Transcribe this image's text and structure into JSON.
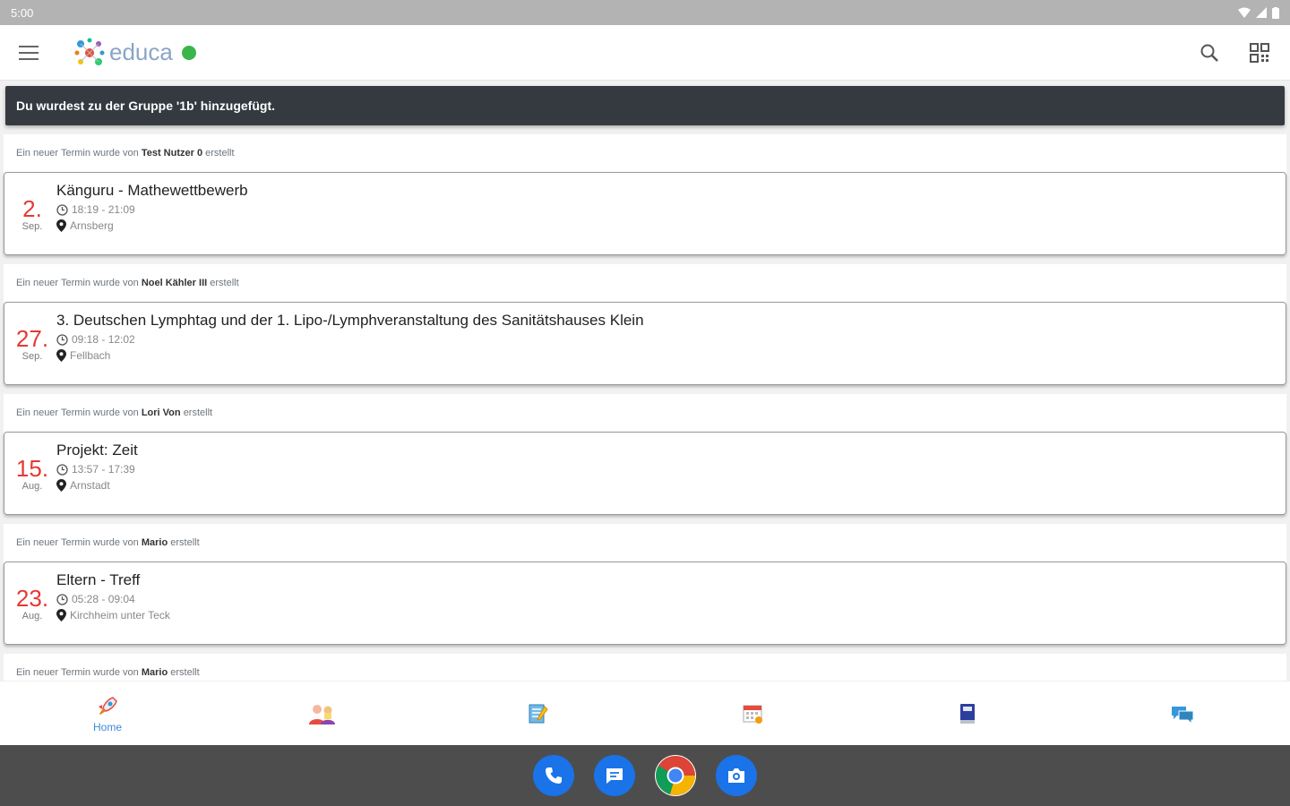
{
  "status": {
    "time": "5:00"
  },
  "app": {
    "logo_text": "educa"
  },
  "notice": "Du wurdest zu der Gruppe '1b' hinzugefügt.",
  "feed": [
    {
      "prefix": "Ein neuer Termin wurde von ",
      "author": "Test Nutzer 0",
      "suffix": " erstellt",
      "day": "2.",
      "month": "Sep.",
      "title": "Känguru - Mathewettbewerb",
      "time": "18:19 - 21:09",
      "location": "Arnsberg"
    },
    {
      "prefix": "Ein neuer Termin wurde von ",
      "author": "Noel Kähler III",
      "suffix": " erstellt",
      "day": "27.",
      "month": "Sep.",
      "title": "3. Deutschen Lymphtag und der 1. Lipo-/Lymphveranstaltung des Sanitätshauses Klein",
      "time": "09:18 - 12:02",
      "location": "Fellbach"
    },
    {
      "prefix": "Ein neuer Termin wurde von ",
      "author": "Lori Von",
      "suffix": " erstellt",
      "day": "15.",
      "month": "Aug.",
      "title": "Projekt: Zeit",
      "time": "13:57 - 17:39",
      "location": "Arnstadt"
    },
    {
      "prefix": "Ein neuer Termin wurde von ",
      "author": "Mario",
      "suffix": " erstellt",
      "day": "23.",
      "month": "Aug.",
      "title": "Eltern - Treff",
      "time": "05:28 - 09:04",
      "location": "Kirchheim unter Teck"
    },
    {
      "prefix": "Ein neuer Termin wurde von ",
      "author": "Mario",
      "suffix": " erstellt"
    }
  ],
  "bottom_nav": {
    "home_label": "Home",
    "icons": [
      "rocket-icon",
      "group-icon",
      "notes-icon",
      "calendar-icon",
      "book-icon",
      "chat-icon"
    ],
    "active_color": "#3f88d8"
  },
  "dock": {
    "apps": [
      "phone-icon",
      "messages-icon",
      "chrome-icon",
      "camera-icon"
    ]
  },
  "colors": {
    "accent_red": "#e53935",
    "online_green": "#3ab54a",
    "snackbar_bg": "#343a40"
  }
}
